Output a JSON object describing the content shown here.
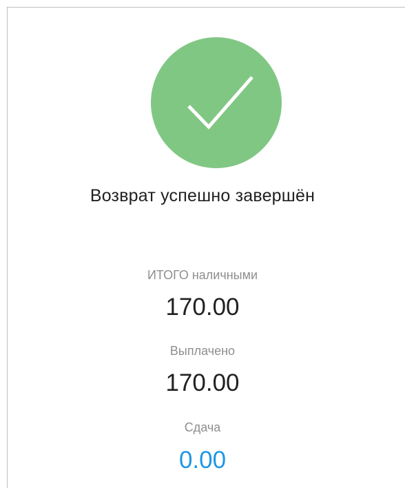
{
  "status": {
    "title": "Возврат успешно завершён",
    "icon": "checkmark-icon",
    "circle_color": "#81c784"
  },
  "summary": {
    "total_label": "ИТОГО наличными",
    "total_value": "170.00",
    "paid_label": "Выплачено",
    "paid_value": "170.00",
    "change_label": "Сдача",
    "change_value": "0.00",
    "change_color": "#1e96e6"
  }
}
